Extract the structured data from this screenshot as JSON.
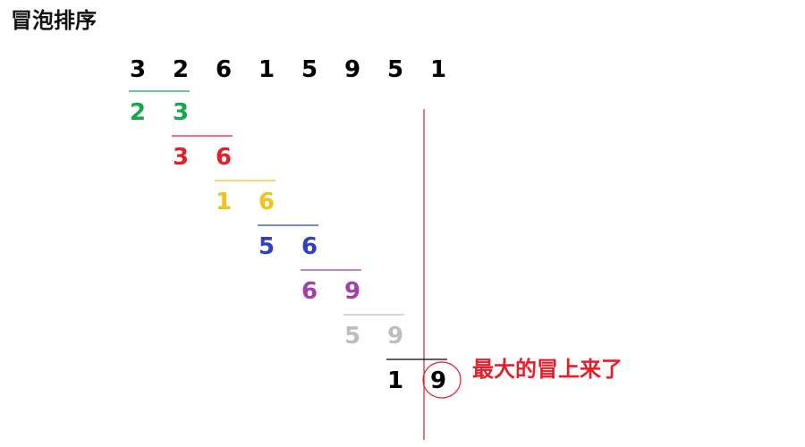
{
  "title": "冒泡排序",
  "sequence": [
    "3",
    "2",
    "6",
    "1",
    "5",
    "9",
    "5",
    "1"
  ],
  "steps": [
    {
      "left": "2",
      "right": "3",
      "color": "#1aa64a"
    },
    {
      "left": "3",
      "right": "6",
      "color": "#e61e2a"
    },
    {
      "left": "1",
      "right": "6",
      "color": "#f2c11a"
    },
    {
      "left": "5",
      "right": "6",
      "color": "#2f3fbf"
    },
    {
      "left": "6",
      "right": "9",
      "color": "#a040a8"
    },
    {
      "left": "5",
      "right": "9",
      "color": "#bdbdbd"
    },
    {
      "left": "1",
      "right": "9",
      "color": "#000000"
    }
  ],
  "colors": {
    "text": "#000000",
    "accent": "#e61e2a",
    "divider": "#c8242b"
  },
  "callout": {
    "text": "最大的冒上来了",
    "color": "#e61e2a"
  }
}
